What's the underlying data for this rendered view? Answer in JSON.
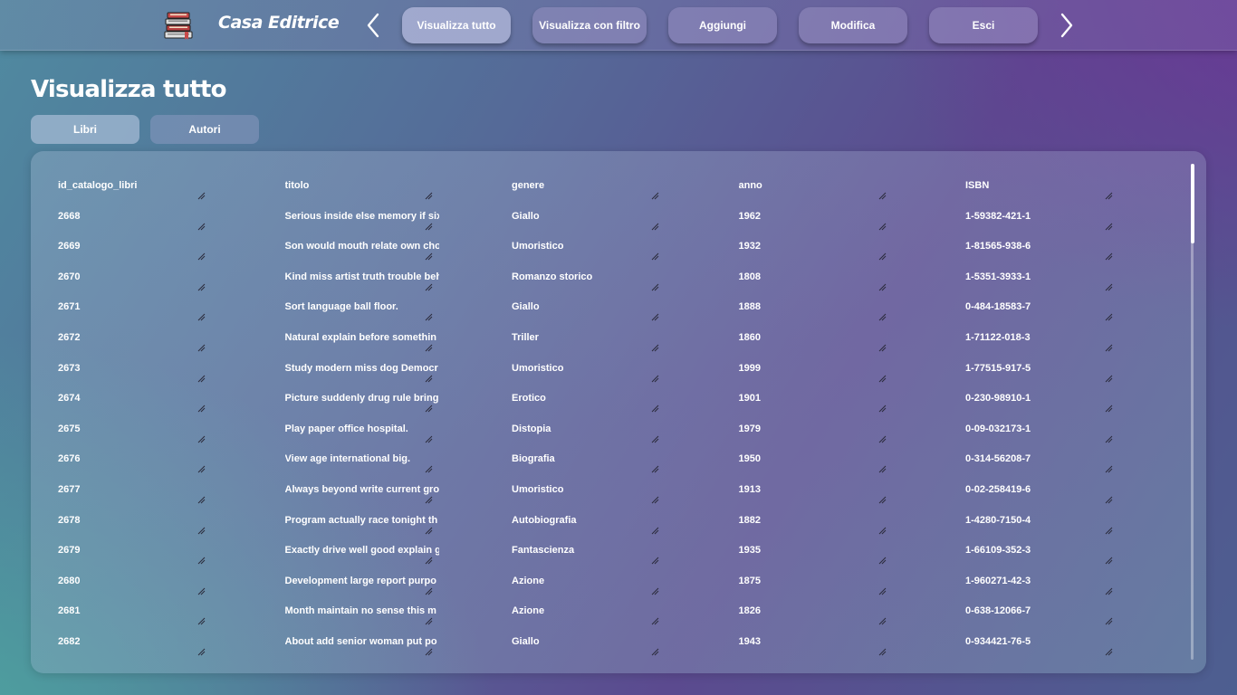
{
  "app": {
    "title": "Casa Editrice",
    "logo_icon": "books-stack-icon"
  },
  "nav": {
    "prev_icon": "chevron-left-icon",
    "next_icon": "chevron-right-icon",
    "buttons": [
      {
        "label": "Visualizza tutto",
        "active": true
      },
      {
        "label": "Visualizza con filtro",
        "active": false
      },
      {
        "label": "Aggiungi",
        "active": false
      },
      {
        "label": "Modifica",
        "active": false
      },
      {
        "label": "Esci",
        "active": false
      }
    ]
  },
  "page": {
    "title": "Visualizza tutto",
    "tabs": [
      {
        "label": "Libri",
        "active": true
      },
      {
        "label": "Autori",
        "active": false
      }
    ]
  },
  "table": {
    "columns": [
      "id_catalogo_libri",
      "titolo",
      "genere",
      "anno",
      "ISBN"
    ],
    "rows": [
      [
        "2668",
        "Serious inside else memory if six",
        "Giallo",
        "1962",
        "1-59382-421-1"
      ],
      [
        "2669",
        "Son would mouth relate own cho",
        "Umoristico",
        "1932",
        "1-81565-938-6"
      ],
      [
        "2670",
        "Kind miss artist truth trouble beh",
        "Romanzo storico",
        "1808",
        "1-5351-3933-1"
      ],
      [
        "2671",
        "Sort language ball floor.",
        "Giallo",
        "1888",
        "0-484-18583-7"
      ],
      [
        "2672",
        "Natural explain before somethin",
        "Triller",
        "1860",
        "1-71122-018-3"
      ],
      [
        "2673",
        "Study modern miss dog Democr",
        "Umoristico",
        "1999",
        "1-77515-917-5"
      ],
      [
        "2674",
        "Picture suddenly drug rule bring",
        "Erotico",
        "1901",
        "0-230-98910-1"
      ],
      [
        "2675",
        "Play paper office hospital.",
        "Distopia",
        "1979",
        "0-09-032173-1"
      ],
      [
        "2676",
        "View age international big.",
        "Biografia",
        "1950",
        "0-314-56208-7"
      ],
      [
        "2677",
        "Always beyond write current gro",
        "Umoristico",
        "1913",
        "0-02-258419-6"
      ],
      [
        "2678",
        "Program actually race tonight th",
        "Autobiografia",
        "1882",
        "1-4280-7150-4"
      ],
      [
        "2679",
        "Exactly drive well good explain g",
        "Fantascienza",
        "1935",
        "1-66109-352-3"
      ],
      [
        "2680",
        "Development large report purpo",
        "Azione",
        "1875",
        "1-960271-42-3"
      ],
      [
        "2681",
        "Month maintain no sense this m",
        "Azione",
        "1826",
        "0-638-12066-7"
      ],
      [
        "2682",
        "About add senior woman put po",
        "Giallo",
        "1943",
        "0-934421-76-5"
      ]
    ],
    "resize_icon": "resize-grip-icon"
  }
}
